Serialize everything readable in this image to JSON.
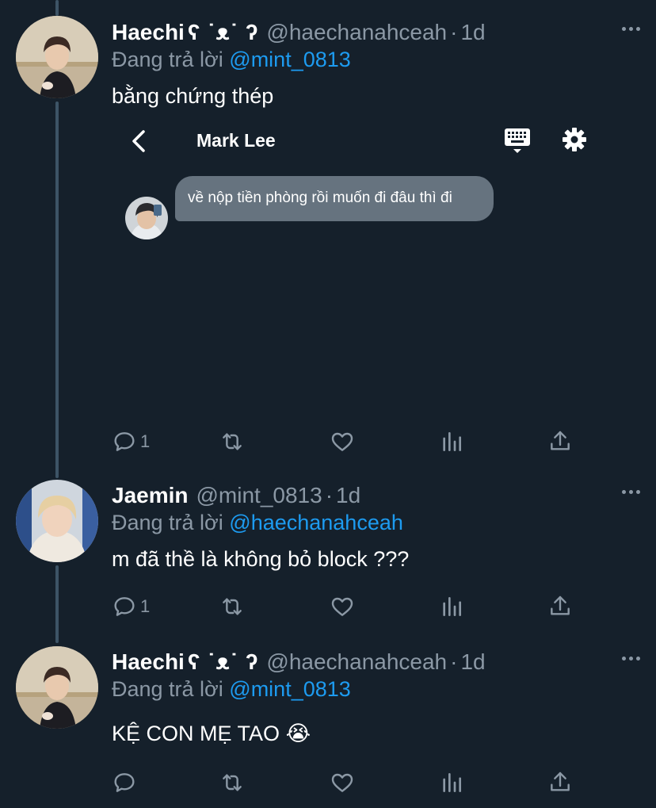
{
  "colors": {
    "background": "#15202b",
    "text_primary": "#ffffff",
    "text_secondary": "#8b98a5",
    "link": "#1d9bf0",
    "thread_line": "#3d5466",
    "dm_bubble": "#66737f"
  },
  "tweets": [
    {
      "display_name": "Haechi",
      "kaomoji": "ʕ ˙ᴥ˙ ʔ",
      "handle": "@haechanahceah",
      "separator": "·",
      "time": "1d",
      "reply_prefix": "Đang trả lời",
      "reply_to": "@mint_0813",
      "text": "bằng chứng thép",
      "reply_count": "1",
      "avatar_icon": "profile-photo",
      "embedded_dm": {
        "contact_name": "Mark Lee",
        "message": "về nộp tiền phòng rồi muốn đi đâu thì đi",
        "icons": [
          "back-chevron-icon",
          "keyboard-icon",
          "gear-icon"
        ]
      }
    },
    {
      "display_name": "Jaemin",
      "handle": "@mint_0813",
      "separator": "·",
      "time": "1d",
      "reply_prefix": "Đang trả lời",
      "reply_to": "@haechanahceah",
      "text": "m đã thề là không bỏ block ???",
      "reply_count": "1",
      "avatar_icon": "profile-photo"
    },
    {
      "display_name": "Haechi",
      "kaomoji": "ʕ ˙ᴥ˙ ʔ",
      "handle": "@haechanahceah",
      "separator": "·",
      "time": "1d",
      "reply_prefix": "Đang trả lời",
      "reply_to": "@mint_0813",
      "text": "KỆ CON MẸ TAO",
      "emoji": "😭",
      "reply_count": "",
      "avatar_icon": "profile-photo"
    }
  ],
  "action_icons": [
    "reply-icon",
    "retweet-icon",
    "like-icon",
    "views-icon",
    "share-icon"
  ],
  "more_icon": "more-options-icon"
}
